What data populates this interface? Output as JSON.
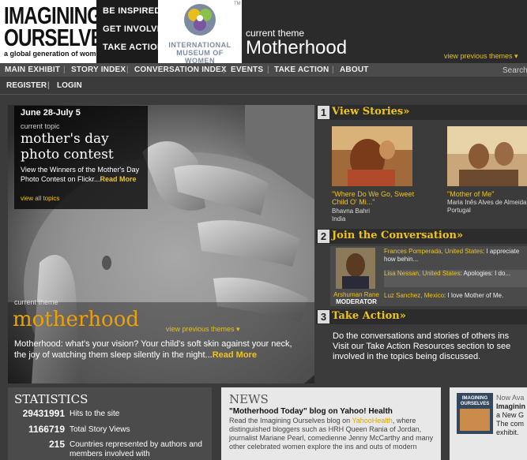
{
  "header": {
    "logo": {
      "line1": "IMAGINING",
      "line2": "OURSELVES",
      "tagline": "a global generation of women"
    },
    "cta": [
      "BE INSPIRED",
      "GET INVOLVED",
      "TAKE ACTION"
    ],
    "museum": {
      "line1": "INTERNATIONAL",
      "line2": "MUSEUM OF WOMEN",
      "tm": "TM"
    },
    "theme_label": "current theme",
    "theme_title": "Motherhood",
    "view_previous": "view previous themes ▾"
  },
  "nav": {
    "items": [
      "MAIN EXHIBIT",
      "STORY INDEX",
      "CONVERSATION INDEX",
      "EVENTS",
      "TAKE ACTION",
      "ABOUT"
    ],
    "separator": "|",
    "search": "Search",
    "secondary": [
      "REGISTER",
      "LOGIN"
    ]
  },
  "hero": {
    "topic_date": "June 28-July 5",
    "topic_label": "current topic",
    "topic_title": "mother's day photo contest",
    "topic_desc": "View the Winners of the Mother's Day Photo Contest on Flickr...",
    "topic_more": "Read More",
    "view_all": "view all topics",
    "theme_label": "current theme",
    "theme_title": "motherhood",
    "view_previous": "view previous themes ▾",
    "desc": "Motherhood: what's your vision? Your child's soft skin against your neck, the joy of watching them sleep silently in the night...",
    "desc_more": "Read More"
  },
  "sections": {
    "stories": {
      "num": "1",
      "title": "View Stories»"
    },
    "conversation": {
      "num": "2",
      "title": "Join the Conversation»"
    },
    "action": {
      "num": "3",
      "title": "Take Action»"
    }
  },
  "stories": [
    {
      "title": "\"Where Do We Go, Sweet Child O' Mi...\"",
      "author": "Bhavna Bahri",
      "country": "India"
    },
    {
      "title": "\"Mother of Me\"",
      "author": "Maria Inês Alves de Almeida",
      "country": "Portugal"
    }
  ],
  "moderator": {
    "name": "Arshuman Rane",
    "role": "MODERATOR"
  },
  "conversation": [
    {
      "who": "Frances Pomperada, United States",
      "text": ": I appreciate how behin..."
    },
    {
      "who": "Lisa Nessan, United States",
      "text": ": Apologies: I do..."
    },
    {
      "who": "Luz Sanchez, Mexico",
      "text": ": I love Mother of Me."
    }
  ],
  "action": {
    "lines": [
      "Do the conversations and stories of others ins",
      "Visit our Take Action Resources section to see",
      "involved in the topics being discussed."
    ]
  },
  "statistics": {
    "title": "STATISTICS",
    "items": [
      {
        "value": "29431991",
        "label": "Hits to the site"
      },
      {
        "value": "1166719",
        "label": "Total Story Views"
      },
      {
        "value": "215",
        "label": "Countries represented by authors and members involved with"
      }
    ]
  },
  "news": {
    "title": "NEWS",
    "headline": "\"Motherhood Today\" blog on Yahoo! Health",
    "body_pre": "Read the Imagining Ourselves blog on ",
    "body_link": "YahooHealth",
    "body_post": ", where distinguished bloggers such as HRH Queen Rania of Jordan, journalist Mariane Pearl, comedienne Jenny McCarthy and many other celebrated women explore the ins and outs of modern"
  },
  "promo": {
    "lines": [
      "Now Ava",
      "Imaginin",
      "a New G",
      "The com",
      "exhibit."
    ],
    "book_text": "IMAGINING OURSELVES"
  },
  "colors": {
    "accent": "#f0c419",
    "orange": "#f0a000",
    "dark": "#2b2b2b",
    "panel": "#4b4b4b"
  }
}
